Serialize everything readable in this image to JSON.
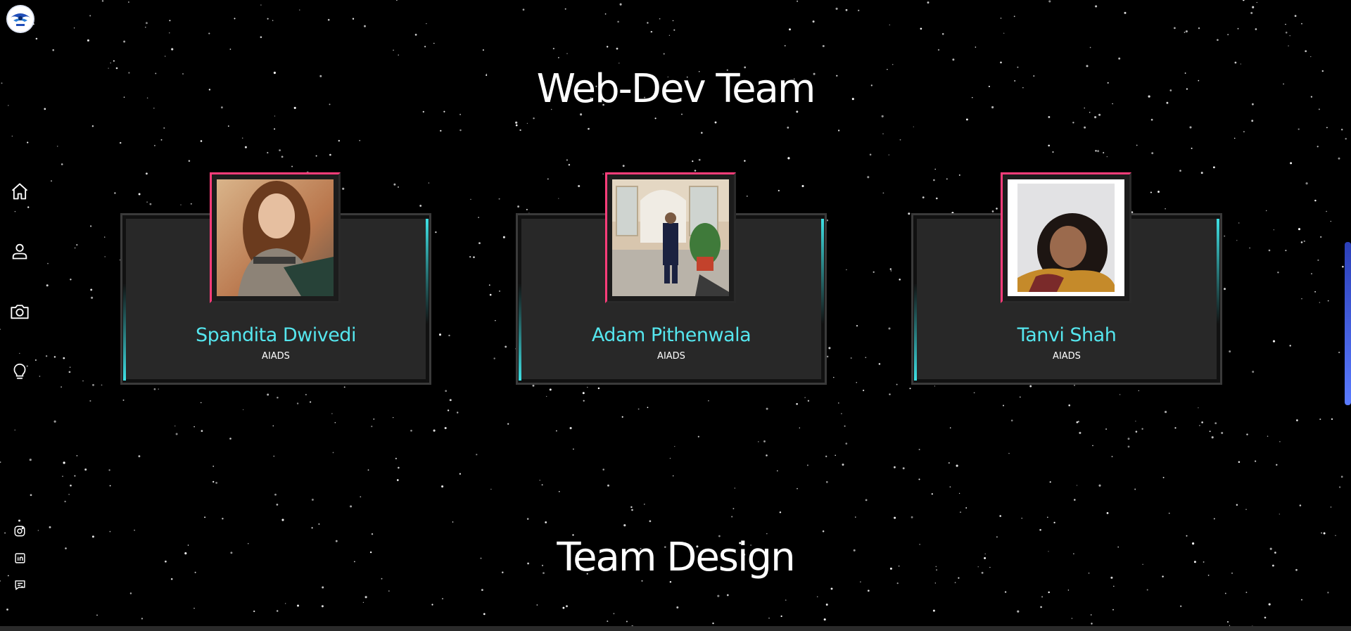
{
  "sections": {
    "webdev_title": "Web-Dev Team",
    "design_title": "Team Design"
  },
  "members": [
    {
      "name": "Spandita Dwivedi",
      "dept": "AIADS"
    },
    {
      "name": "Adam Pithenwala",
      "dept": "AIADS"
    },
    {
      "name": "Tanvi Shah",
      "dept": "AIADS"
    }
  ],
  "nav": {
    "icons": [
      "home-icon",
      "user-icon",
      "camera-icon",
      "lightbulb-icon"
    ]
  },
  "social": {
    "icons": [
      "instagram-icon",
      "linkedin-icon",
      "message-icon"
    ]
  },
  "colors": {
    "background": "#000000",
    "accent_cyan": "#55e6ee",
    "accent_pink": "#ff3d7a",
    "card_bg": "#282828",
    "scrollbar": "#3b55e0"
  }
}
